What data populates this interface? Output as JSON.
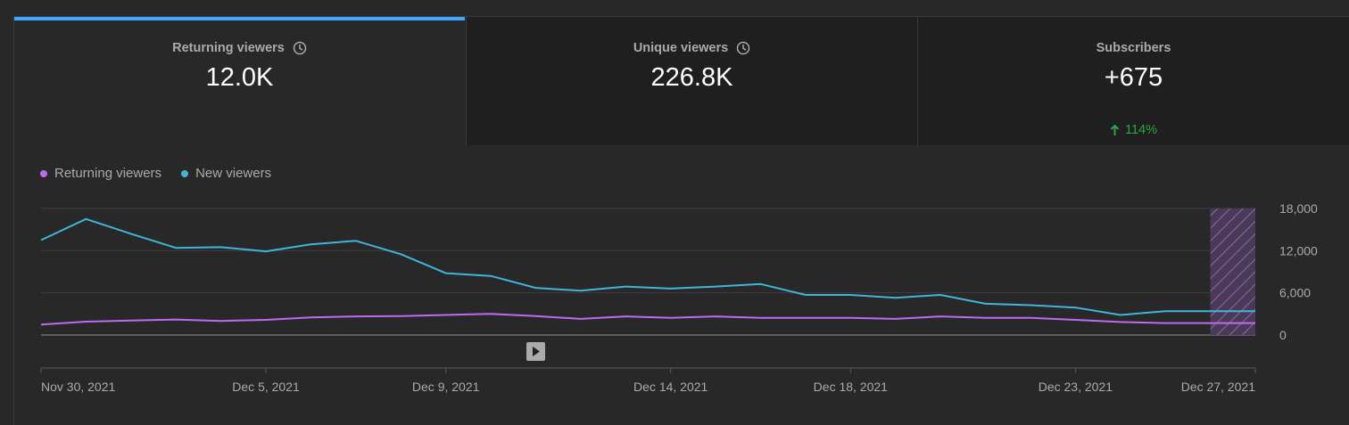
{
  "tabs": [
    {
      "label": "Returning viewers",
      "value": "12.0K",
      "has_clock": true,
      "active": true
    },
    {
      "label": "Unique viewers",
      "value": "226.8K",
      "has_clock": true,
      "active": false
    },
    {
      "label": "Subscribers",
      "value": "+675",
      "change": "114%",
      "change_icon": "arrow-up-icon",
      "has_clock": false,
      "active": false
    }
  ],
  "colors": {
    "returning": "#c06af0",
    "new": "#3fb6d8",
    "accent": "#3ea6ff",
    "positive": "#2ba640"
  },
  "chart_data": {
    "type": "line",
    "x": [
      "Nov 30, 2021",
      "Dec 1, 2021",
      "Dec 2, 2021",
      "Dec 3, 2021",
      "Dec 4, 2021",
      "Dec 5, 2021",
      "Dec 6, 2021",
      "Dec 7, 2021",
      "Dec 8, 2021",
      "Dec 9, 2021",
      "Dec 10, 2021",
      "Dec 11, 2021",
      "Dec 12, 2021",
      "Dec 13, 2021",
      "Dec 14, 2021",
      "Dec 15, 2021",
      "Dec 16, 2021",
      "Dec 17, 2021",
      "Dec 18, 2021",
      "Dec 19, 2021",
      "Dec 20, 2021",
      "Dec 21, 2021",
      "Dec 22, 2021",
      "Dec 23, 2021",
      "Dec 24, 2021",
      "Dec 25, 2021",
      "Dec 26, 2021",
      "Dec 27, 2021"
    ],
    "series": [
      {
        "name": "Returning viewers",
        "values": [
          1500,
          1900,
          2050,
          2200,
          2000,
          2150,
          2500,
          2650,
          2700,
          2850,
          3000,
          2700,
          2300,
          2650,
          2450,
          2650,
          2450,
          2450,
          2450,
          2300,
          2650,
          2450,
          2450,
          2150,
          1850,
          1700,
          1700,
          1700
        ]
      },
      {
        "name": "New viewers",
        "values": [
          13500,
          16500,
          14400,
          12400,
          12500,
          11900,
          12900,
          13400,
          11500,
          8800,
          8400,
          6700,
          6300,
          6900,
          6600,
          6900,
          7250,
          5700,
          5700,
          5300,
          5700,
          4450,
          4250,
          3900,
          2850,
          3400,
          3400,
          3400
        ]
      }
    ],
    "x_tick_labels": [
      "Nov 30, 2021",
      "Dec 5, 2021",
      "Dec 9, 2021",
      "Dec 14, 2021",
      "Dec 18, 2021",
      "Dec 23, 2021",
      "Dec 27, 2021"
    ],
    "y_ticks": [
      0,
      6000,
      12000,
      18000
    ],
    "y_tick_labels": [
      "0",
      "6,000",
      "12,000",
      "18,000"
    ],
    "ylim": [
      0,
      18000
    ],
    "partial_data_from": "Dec 27, 2021",
    "grid": true,
    "legend": "top-left"
  }
}
